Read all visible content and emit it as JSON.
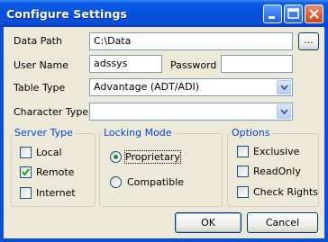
{
  "window": {
    "title": "Configure Settings"
  },
  "form": {
    "data_path_label": "Data Path",
    "data_path_value": "C:\\Data",
    "browse_label": "...",
    "user_name_label": "User Name",
    "user_name_value": "adssys",
    "password_label": "Password",
    "password_value": "",
    "table_type_label": "Table Type",
    "table_type_value": "Advantage (ADT/ADI)",
    "character_type_label": "Character Type",
    "character_type_value": ""
  },
  "server_type": {
    "legend": "Server Type",
    "options": [
      {
        "label": "Local",
        "checked": false
      },
      {
        "label": "Remote",
        "checked": true
      },
      {
        "label": "Internet",
        "checked": false
      }
    ]
  },
  "locking_mode": {
    "legend": "Locking Mode",
    "options": [
      {
        "label": "Proprietary",
        "selected": true
      },
      {
        "label": "Compatible",
        "selected": false
      }
    ]
  },
  "options": {
    "legend": "Options",
    "items": [
      {
        "label": "Exclusive",
        "checked": false
      },
      {
        "label": "ReadOnly",
        "checked": false
      },
      {
        "label": "Check Rights",
        "checked": false
      }
    ]
  },
  "buttons": {
    "ok": "OK",
    "cancel": "Cancel"
  }
}
